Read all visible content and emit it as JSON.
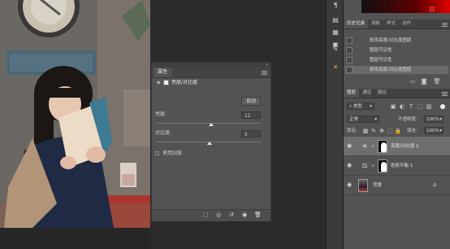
{
  "properties": {
    "tab": "属性",
    "adjustment_name": "亮度/对比度",
    "auto_label": "自动",
    "brightness_label": "亮度:",
    "brightness_value": "11",
    "brightness_fraction": 0.52,
    "contrast_label": "对比度:",
    "contrast_value": "5",
    "contrast_fraction": 0.51,
    "legacy_label": "使用旧版"
  },
  "history": {
    "tabs": [
      "历史记录",
      "调板",
      "样式",
      "动作"
    ],
    "items": [
      "修改亮度/对比度图层",
      "图层可见性",
      "图层可见性",
      "修改亮度/对比度图层"
    ],
    "selected_index": 3
  },
  "layers": {
    "tabs": [
      "图层",
      "通道",
      "路径"
    ],
    "kind_filter": "类型",
    "blend_mode": "正常",
    "opacity_label": "不透明度:",
    "opacity_value": "100%",
    "lock_label": "锁定:",
    "fill_label": "填充:",
    "fill_value": "100%",
    "items": [
      {
        "name": "亮度/对比度 1",
        "selected": true
      },
      {
        "name": "色彩平衡 1",
        "selected": false
      },
      {
        "name": "背景",
        "selected": false
      }
    ]
  },
  "colors": {
    "panel": "#535353",
    "dark": "#2b2b2b",
    "selected": "#6e6e6e"
  }
}
